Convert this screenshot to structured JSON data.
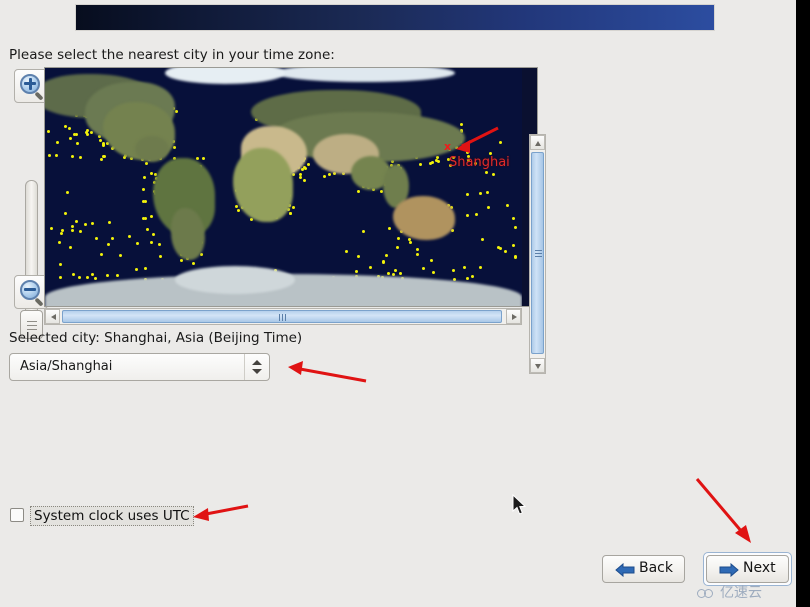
{
  "window": {
    "background_color": "#ebeae8",
    "banner_gradient_from": "#070d1e",
    "banner_gradient_to": "#2c4da0"
  },
  "prompt": {
    "text": "Please select the nearest city in your time zone:"
  },
  "map": {
    "zoom_in_title": "Zoom in",
    "zoom_out_title": "Zoom out",
    "slider_title": "Zoom level",
    "ocean_color": "#07103a",
    "city_dot_color": "#f2f20a",
    "marker": {
      "symbol": "x",
      "label": "Shanghai",
      "color": "#e02b2b"
    },
    "vscroll": {
      "up_arrow": "▲",
      "down_arrow": "▼"
    },
    "hscroll": {
      "left_arrow": "◀",
      "right_arrow": "▶"
    }
  },
  "selection": {
    "selected_city_text": "Selected city: Shanghai, Asia (Beijing Time)",
    "timezone_value": "Asia/Shanghai",
    "timezone_placeholder": "Asia/Shanghai"
  },
  "options": {
    "utc_checkbox_label": "System clock uses UTC",
    "utc_checked": false
  },
  "buttons": {
    "back_label": "Back",
    "next_label": "Next",
    "accent_color": "#2f6ab5"
  },
  "watermark": {
    "text": "亿速云"
  }
}
